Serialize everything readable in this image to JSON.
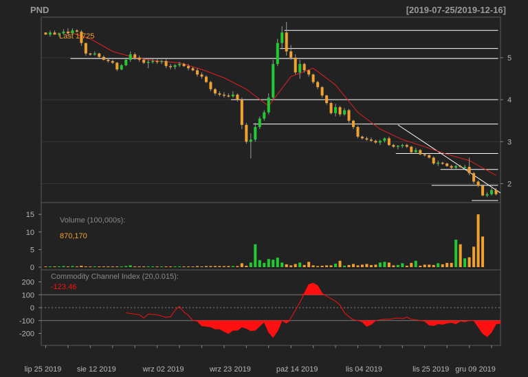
{
  "header": {
    "symbol": "PND",
    "range": "[2019-07-25/2019-12-16]"
  },
  "colors": {
    "bg": "#222222",
    "panel_border": "#5a5a5a",
    "up": "#22c933",
    "down": "#f0a030",
    "ma": "#e22020",
    "cci": "#ff1010",
    "sr": "#ffffff",
    "grid": "#3a3a3a"
  },
  "price_panel": {
    "last_label": "Last 1.725",
    "ylim": [
      1.55,
      5.9
    ],
    "yticks": [
      "2",
      "3",
      "4",
      "5"
    ]
  },
  "volume_panel": {
    "title": "Volume (100,000s):",
    "value": "870,170",
    "ylim": [
      0,
      16
    ],
    "yticks": [
      "0",
      "5",
      "10",
      "15"
    ]
  },
  "cci_panel": {
    "title": "Commodity Channel Index (20,0.015):",
    "value": "-123.46",
    "ylim": [
      -240,
      240
    ],
    "yticks": [
      "200",
      "100",
      "0",
      "-100",
      "-200"
    ]
  },
  "x_axis": {
    "labels": [
      "lip 25 2019",
      "sie 12 2019",
      "wrz 02 2019",
      "wrz 23 2019",
      "paź 14 2019",
      "lis 04 2019",
      "lis 25 2019",
      "gru 09 2019"
    ],
    "label_index": [
      0,
      12,
      27,
      42,
      57,
      72,
      87,
      97
    ]
  },
  "chart_data": {
    "type": "candlestick",
    "n": 102,
    "ohlc": [
      [
        5.6,
        5.6,
        5.55,
        5.55
      ],
      [
        5.55,
        5.65,
        5.5,
        5.6
      ],
      [
        5.6,
        5.65,
        5.55,
        5.55
      ],
      [
        5.55,
        5.6,
        5.5,
        5.58
      ],
      [
        5.58,
        5.68,
        5.55,
        5.62
      ],
      [
        5.62,
        5.7,
        5.55,
        5.58
      ],
      [
        5.58,
        5.7,
        5.55,
        5.65
      ],
      [
        5.65,
        5.68,
        5.6,
        5.62
      ],
      [
        5.62,
        5.66,
        5.28,
        5.35
      ],
      [
        5.35,
        5.35,
        5.05,
        5.1
      ],
      [
        5.1,
        5.12,
        5.05,
        5.08
      ],
      [
        5.08,
        5.15,
        5.05,
        5.1
      ],
      [
        5.1,
        5.12,
        4.98,
        5.02
      ],
      [
        5.02,
        5.05,
        4.93,
        4.95
      ],
      [
        4.95,
        4.98,
        4.88,
        4.92
      ],
      [
        4.92,
        4.95,
        4.85,
        4.88
      ],
      [
        4.88,
        4.9,
        4.68,
        4.72
      ],
      [
        4.72,
        4.85,
        4.7,
        4.82
      ],
      [
        4.82,
        5.0,
        4.8,
        4.95
      ],
      [
        4.95,
        5.15,
        4.9,
        5.08
      ],
      [
        5.08,
        5.12,
        4.95,
        5.0
      ],
      [
        5.0,
        5.05,
        4.9,
        4.95
      ],
      [
        4.95,
        4.98,
        4.85,
        4.88
      ],
      [
        4.88,
        4.95,
        4.75,
        4.9
      ],
      [
        4.9,
        4.98,
        4.86,
        4.92
      ],
      [
        4.92,
        4.98,
        4.85,
        4.9
      ],
      [
        4.9,
        4.95,
        4.85,
        4.92
      ],
      [
        4.92,
        4.96,
        4.75,
        4.8
      ],
      [
        4.8,
        4.85,
        4.72,
        4.78
      ],
      [
        4.78,
        4.85,
        4.72,
        4.82
      ],
      [
        4.82,
        4.9,
        4.78,
        4.85
      ],
      [
        4.85,
        4.88,
        4.78,
        4.8
      ],
      [
        4.8,
        4.85,
        4.7,
        4.75
      ],
      [
        4.75,
        4.78,
        4.68,
        4.7
      ],
      [
        4.7,
        4.75,
        4.55,
        4.6
      ],
      [
        4.6,
        4.65,
        4.5,
        4.55
      ],
      [
        4.55,
        4.58,
        4.4,
        4.42
      ],
      [
        4.42,
        4.45,
        4.2,
        4.25
      ],
      [
        4.25,
        4.28,
        4.1,
        4.15
      ],
      [
        4.15,
        4.2,
        4.08,
        4.12
      ],
      [
        4.12,
        4.18,
        4.05,
        4.1
      ],
      [
        4.1,
        4.15,
        4.05,
        4.08
      ],
      [
        4.08,
        4.2,
        4.05,
        4.12
      ],
      [
        4.12,
        4.15,
        3.95,
        4.0
      ],
      [
        4.0,
        4.05,
        3.3,
        3.4
      ],
      [
        3.4,
        3.45,
        2.95,
        3.0
      ],
      [
        3.0,
        3.2,
        2.6,
        3.05
      ],
      [
        3.05,
        3.45,
        3.0,
        3.35
      ],
      [
        3.35,
        3.6,
        3.3,
        3.55
      ],
      [
        3.55,
        3.75,
        3.5,
        3.7
      ],
      [
        3.7,
        4.15,
        3.65,
        4.05
      ],
      [
        4.05,
        4.95,
        4.0,
        4.85
      ],
      [
        4.85,
        5.45,
        4.8,
        5.35
      ],
      [
        5.35,
        5.75,
        5.2,
        5.6
      ],
      [
        5.6,
        5.85,
        5.05,
        5.15
      ],
      [
        5.15,
        5.3,
        4.95,
        5.0
      ],
      [
        5.0,
        5.08,
        4.6,
        4.65
      ],
      [
        4.65,
        4.95,
        4.5,
        4.85
      ],
      [
        4.85,
        4.88,
        4.65,
        4.7
      ],
      [
        4.7,
        4.72,
        4.55,
        4.6
      ],
      [
        4.6,
        4.62,
        4.38,
        4.42
      ],
      [
        4.42,
        4.45,
        4.25,
        4.3
      ],
      [
        4.3,
        4.32,
        4.05,
        4.1
      ],
      [
        4.1,
        4.12,
        3.88,
        3.92
      ],
      [
        3.92,
        3.95,
        3.65,
        3.68
      ],
      [
        3.68,
        3.9,
        3.6,
        3.82
      ],
      [
        3.82,
        3.85,
        3.6,
        3.65
      ],
      [
        3.65,
        3.8,
        3.62,
        3.75
      ],
      [
        3.75,
        3.78,
        3.45,
        3.5
      ],
      [
        3.5,
        3.52,
        3.3,
        3.35
      ],
      [
        3.35,
        3.38,
        3.08,
        3.12
      ],
      [
        3.12,
        3.15,
        3.05,
        3.08
      ],
      [
        3.08,
        3.12,
        3.02,
        3.05
      ],
      [
        3.05,
        3.1,
        3.0,
        3.02
      ],
      [
        3.02,
        3.05,
        2.95,
        2.98
      ],
      [
        2.98,
        3.05,
        2.92,
        3.02
      ],
      [
        3.02,
        3.1,
        2.98,
        3.08
      ],
      [
        3.08,
        3.12,
        2.9,
        2.92
      ],
      [
        2.92,
        2.95,
        2.85,
        2.88
      ],
      [
        2.88,
        2.92,
        2.82,
        2.9
      ],
      [
        2.9,
        2.95,
        2.85,
        2.92
      ],
      [
        2.92,
        2.95,
        2.85,
        2.88
      ],
      [
        2.88,
        2.9,
        2.72,
        2.75
      ],
      [
        2.75,
        2.85,
        2.72,
        2.8
      ],
      [
        2.8,
        2.82,
        2.68,
        2.7
      ],
      [
        2.7,
        2.72,
        2.65,
        2.68
      ],
      [
        2.68,
        2.7,
        2.6,
        2.62
      ],
      [
        2.62,
        2.65,
        2.45,
        2.48
      ],
      [
        2.48,
        2.55,
        2.42,
        2.5
      ],
      [
        2.5,
        2.52,
        2.45,
        2.48
      ],
      [
        2.48,
        2.5,
        2.4,
        2.42
      ],
      [
        2.42,
        2.45,
        2.35,
        2.38
      ],
      [
        2.38,
        2.45,
        2.35,
        2.42
      ],
      [
        2.42,
        2.45,
        2.38,
        2.4
      ],
      [
        2.4,
        2.45,
        2.35,
        2.4
      ],
      [
        2.4,
        2.62,
        2.2,
        2.25
      ],
      [
        2.25,
        2.28,
        2.0,
        2.05
      ],
      [
        2.05,
        2.08,
        1.92,
        1.95
      ],
      [
        1.95,
        1.98,
        1.7,
        1.72
      ],
      [
        1.72,
        1.8,
        1.68,
        1.75
      ],
      [
        1.75,
        1.9,
        1.72,
        1.85
      ],
      [
        1.85,
        1.9,
        1.72,
        1.75
      ]
    ],
    "ma": [
      [
        5,
        5.62
      ],
      [
        10,
        5.45
      ],
      [
        15,
        5.15
      ],
      [
        20,
        5.0
      ],
      [
        25,
        4.92
      ],
      [
        30,
        4.88
      ],
      [
        35,
        4.72
      ],
      [
        40,
        4.52
      ],
      [
        45,
        4.25
      ],
      [
        50,
        3.85
      ],
      [
        55,
        4.55
      ],
      [
        60,
        4.75
      ],
      [
        65,
        4.35
      ],
      [
        70,
        3.7
      ],
      [
        75,
        3.3
      ],
      [
        80,
        3.05
      ],
      [
        85,
        2.88
      ],
      [
        90,
        2.7
      ],
      [
        95,
        2.55
      ],
      [
        101,
        2.2
      ]
    ],
    "sr_lines": [
      {
        "x0": 54,
        "x1": 101,
        "y": 5.65
      },
      {
        "x0": 53,
        "x1": 101,
        "y": 5.22
      },
      {
        "x0": 6,
        "x1": 101,
        "y": 4.98
      },
      {
        "x0": 42,
        "x1": 101,
        "y": 4.0
      },
      {
        "x0": 47,
        "x1": 101,
        "y": 3.42
      },
      {
        "x0": 79,
        "x1": 101,
        "y": 2.72
      },
      {
        "x0": 89,
        "x1": 101,
        "y": 2.34
      },
      {
        "x0": 87,
        "x1": 101,
        "y": 1.96
      },
      {
        "x0": 96,
        "x1": 101,
        "y": 1.6
      }
    ],
    "trendline": {
      "x0": 79,
      "y0": 3.4,
      "x1": 102,
      "y1": 1.78
    },
    "volume": [
      0.2,
      0.2,
      0.2,
      0.2,
      0.3,
      0.2,
      0.3,
      0.2,
      0.4,
      0.2,
      0.2,
      0.2,
      0.2,
      0.2,
      0.2,
      0.2,
      0.2,
      0.2,
      0.3,
      0.5,
      0.2,
      0.2,
      0.2,
      0.2,
      0.2,
      0.2,
      0.2,
      0.2,
      0.2,
      0.2,
      0.2,
      0.2,
      0.2,
      0.2,
      0.3,
      0.2,
      0.3,
      0.3,
      0.3,
      0.3,
      0.3,
      0.3,
      0.3,
      0.3,
      1.1,
      0.4,
      1.3,
      6.5,
      2.0,
      1.2,
      2.3,
      2.1,
      2.7,
      1.3,
      0.8,
      0.5,
      0.9,
      1.3,
      0.6,
      1.5,
      0.5,
      0.3,
      0.4,
      0.5,
      0.5,
      1.0,
      1.8,
      0.4,
      0.6,
      0.9,
      0.5,
      0.7,
      0.9,
      0.6,
      0.7,
      1.3,
      1.5,
      1.3,
      0.5,
      0.6,
      1.1,
      0.4,
      1.2,
      1.8,
      0.4,
      0.7,
      0.7,
      0.6,
      1.1,
      0.8,
      1.2,
      1.2,
      7.8,
      6.5,
      2.5,
      2.8,
      5.8,
      15.0,
      8.7
    ],
    "cci": [
      [
        18,
        -40
      ],
      [
        19,
        -45
      ],
      [
        21,
        -55
      ],
      [
        22,
        -80
      ],
      [
        23,
        -50
      ],
      [
        25,
        -55
      ],
      [
        27,
        -75
      ],
      [
        28,
        -70
      ],
      [
        29,
        -20
      ],
      [
        30,
        10
      ],
      [
        31,
        -35
      ],
      [
        32,
        -60
      ],
      [
        33,
        -100
      ],
      [
        34,
        -105
      ],
      [
        35,
        -140
      ],
      [
        37,
        -150
      ],
      [
        38,
        -165
      ],
      [
        39,
        -165
      ],
      [
        40,
        -185
      ],
      [
        41,
        -200
      ],
      [
        42,
        -175
      ],
      [
        43,
        -175
      ],
      [
        44,
        -150
      ],
      [
        45,
        -160
      ],
      [
        46,
        -180
      ],
      [
        47,
        -175
      ],
      [
        49,
        -110
      ],
      [
        50,
        -190
      ],
      [
        51,
        -230
      ],
      [
        52,
        -180
      ],
      [
        53,
        -100
      ],
      [
        54,
        -120
      ],
      [
        55,
        -80
      ],
      [
        56,
        -20
      ],
      [
        57,
        40
      ],
      [
        58,
        110
      ],
      [
        59,
        180
      ],
      [
        60,
        190
      ],
      [
        61,
        170
      ],
      [
        62,
        110
      ],
      [
        63,
        90
      ],
      [
        64,
        70
      ],
      [
        65,
        50
      ],
      [
        66,
        20
      ],
      [
        67,
        -40
      ],
      [
        68,
        -70
      ],
      [
        69,
        -95
      ],
      [
        70,
        -100
      ],
      [
        71,
        -110
      ],
      [
        72,
        -145
      ],
      [
        73,
        -130
      ],
      [
        74,
        -100
      ],
      [
        75,
        -95
      ],
      [
        76,
        -90
      ],
      [
        77,
        -90
      ],
      [
        78,
        -85
      ],
      [
        79,
        -80
      ],
      [
        80,
        -85
      ],
      [
        81,
        -75
      ],
      [
        82,
        -90
      ],
      [
        83,
        -95
      ],
      [
        84,
        -100
      ],
      [
        85,
        -105
      ],
      [
        86,
        -135
      ],
      [
        87,
        -140
      ],
      [
        88,
        -125
      ],
      [
        89,
        -130
      ],
      [
        90,
        -120
      ],
      [
        91,
        -115
      ],
      [
        92,
        -125
      ],
      [
        93,
        -105
      ],
      [
        94,
        -110
      ],
      [
        95,
        -100
      ],
      [
        96,
        -100
      ],
      [
        97,
        -150
      ],
      [
        98,
        -200
      ],
      [
        99,
        -225
      ],
      [
        100,
        -190
      ],
      [
        101,
        -125
      ],
      [
        102,
        -123
      ]
    ]
  }
}
